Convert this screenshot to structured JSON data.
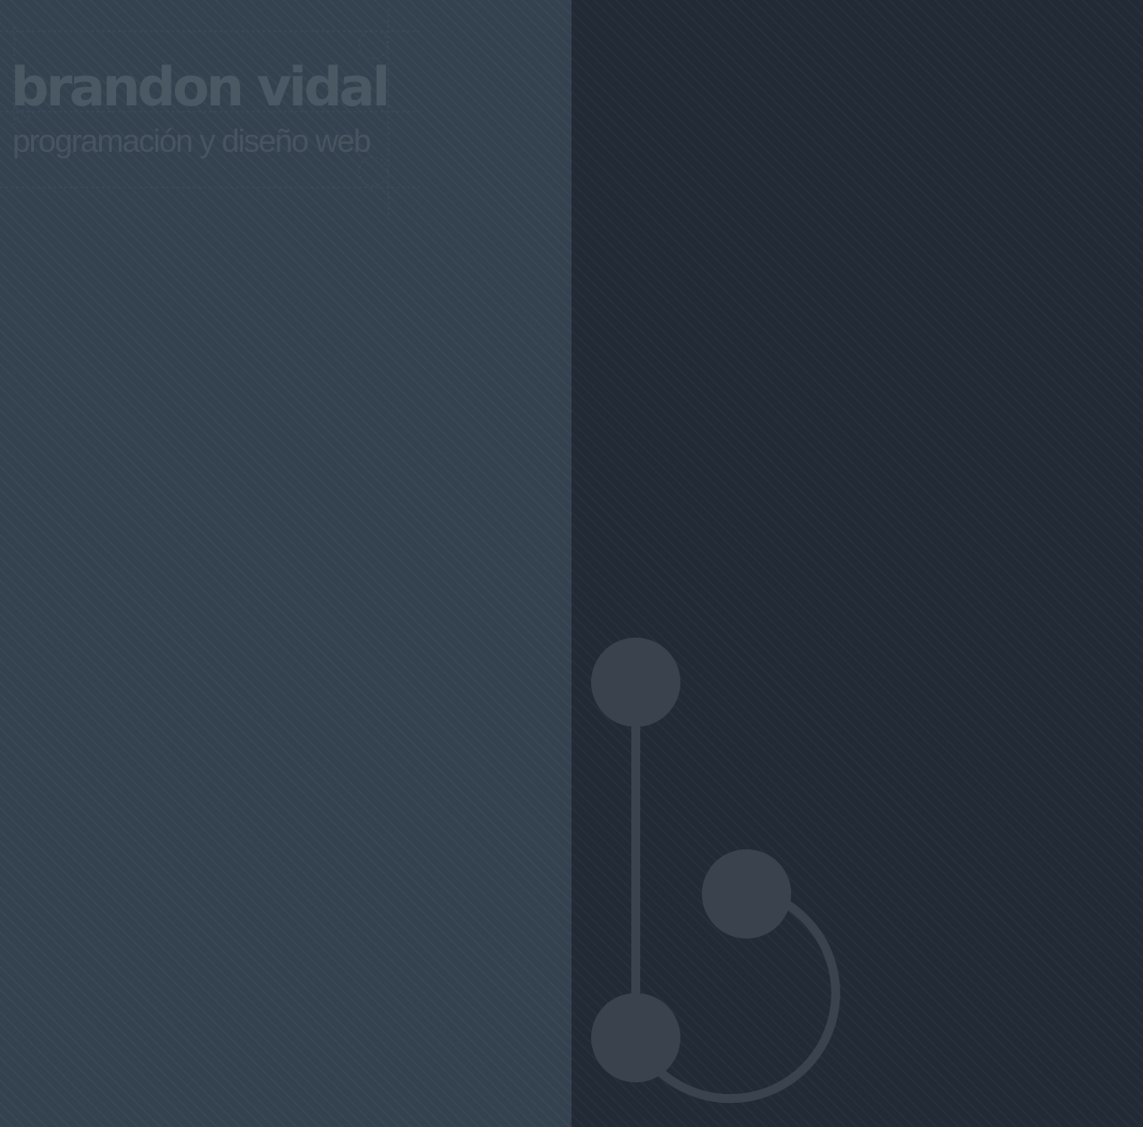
{
  "brand": {
    "name": "brandon vidal",
    "tagline": "programación y diseño web"
  },
  "colors": {
    "left_panel": "#34424f",
    "right_panel": "#222a35",
    "logo_mark": "#3a434d",
    "brand_text": "#4a5864"
  },
  "icons": {
    "logo": "bv-logo-icon"
  }
}
